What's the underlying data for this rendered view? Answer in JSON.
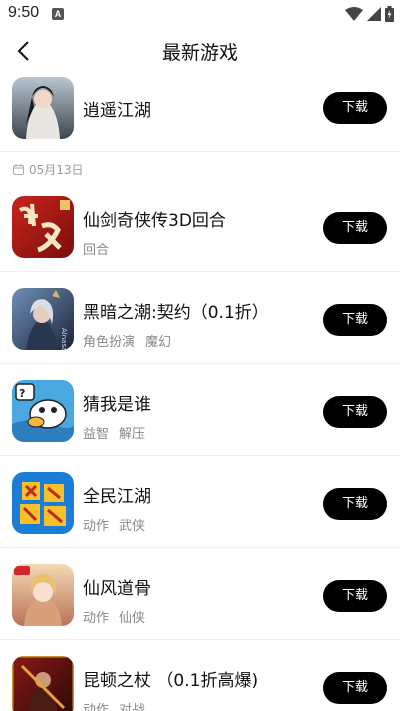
{
  "status": {
    "time": "9:50",
    "notif_letter": "A"
  },
  "header": {
    "title": "最新游戏"
  },
  "date_label": "05月13日",
  "download_label": "下载",
  "games": [
    {
      "name": "逍遥江湖",
      "tags": [],
      "icon": "xiaoyao-jianghu-icon"
    },
    {
      "name": "仙剑奇侠传3D回合",
      "tags": [
        "回合"
      ],
      "icon": "xianjian-icon"
    },
    {
      "name": "黑暗之潮:契约（0.1折）",
      "tags": [
        "角色扮演",
        "魔幻"
      ],
      "icon": "dark-tide-icon"
    },
    {
      "name": "猜我是谁",
      "tags": [
        "益智",
        "解压"
      ],
      "icon": "guess-who-icon"
    },
    {
      "name": "全民江湖",
      "tags": [
        "动作",
        "武侠"
      ],
      "icon": "quanmin-jianghu-icon"
    },
    {
      "name": "仙风道骨",
      "tags": [
        "动作",
        "仙侠"
      ],
      "icon": "xianfeng-daogu-icon"
    },
    {
      "name": "昆顿之杖 （0.1折高爆)",
      "tags": [
        "动作",
        "对战"
      ],
      "icon": "kundun-staff-icon"
    }
  ]
}
